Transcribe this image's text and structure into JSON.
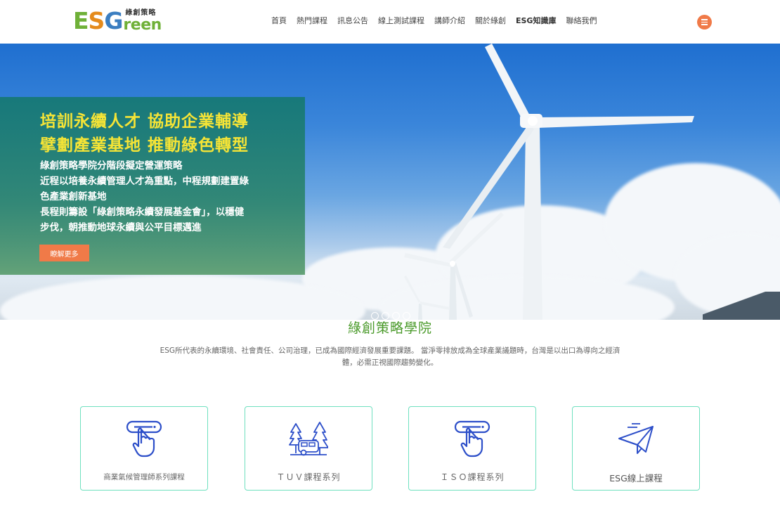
{
  "header": {
    "logo": {
      "e": "E",
      "s": "S",
      "g": "G",
      "reen": "reen",
      "sub": "綠創策略"
    },
    "nav": [
      {
        "label": "首頁"
      },
      {
        "label": "熱門課程"
      },
      {
        "label": "訊息公告"
      },
      {
        "label": "線上測試課程"
      },
      {
        "label": "講師介紹"
      },
      {
        "label": "關於綠創"
      },
      {
        "label": "ESG知識庫"
      },
      {
        "label": "聯絡我們"
      }
    ],
    "menu_icon": "hamburger-icon"
  },
  "hero": {
    "title_line1": "培訓永續人才 協助企業輔導",
    "title_line2": "擘劃產業基地 推動綠色轉型",
    "lines": [
      "綠創策略學院分階段擬定營運策略",
      "近程以培養永續管理人才為重點，中程規劃建置綠",
      "色產業創新基地",
      "長程則籌設「綠創策略永續發展基金會」，以穩健",
      "步伐，朝推動地球永續與公平目標邁進"
    ],
    "cta_label": "瞭解更多",
    "slides_count": 4
  },
  "intro": {
    "title": "綠創策略學院",
    "desc_line1": "ESG所代表的永續環境、社會責任、公司治理，已成為國際經濟發展重要課題。 當淨零排放成為全球產業議題時，台灣是以出口為導向之經濟",
    "desc_line2": "體，必需正視國際趨勢變化。"
  },
  "cards": [
    {
      "label": "商業氣候管理師系列課程",
      "icon": "touch-icon"
    },
    {
      "label": "ＴＵＶ課程系列",
      "icon": "camper-trees-icon"
    },
    {
      "label": "ＩＳＯ課程系列",
      "icon": "touch-icon"
    },
    {
      "label": "ESG線上課程",
      "icon": "paper-plane-icon"
    }
  ],
  "colors": {
    "accent": "#f07a48",
    "green": "#4a9a2a",
    "card_border": "#6fe0bf",
    "icon_blue": "#2d4fc9",
    "hero_title": "#f5e436"
  }
}
